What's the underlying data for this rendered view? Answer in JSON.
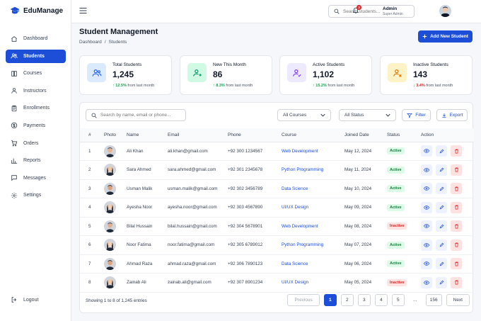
{
  "app": {
    "name": "EduManage"
  },
  "nav": [
    {
      "label": "Dashboard",
      "icon": "home-icon"
    },
    {
      "label": "Students",
      "icon": "students-icon",
      "active": true
    },
    {
      "label": "Courses",
      "icon": "book-icon"
    },
    {
      "label": "Instructors",
      "icon": "user-icon"
    },
    {
      "label": "Enrollments",
      "icon": "clipboard-icon"
    },
    {
      "label": "Payments",
      "icon": "dollar-icon"
    },
    {
      "label": "Orders",
      "icon": "cart-icon"
    },
    {
      "label": "Reports",
      "icon": "chart-icon"
    },
    {
      "label": "Messages",
      "icon": "message-icon"
    },
    {
      "label": "Settings",
      "icon": "gear-icon"
    }
  ],
  "logout": "Logout",
  "header": {
    "search_placeholder": "Search students...",
    "notification_count": "3",
    "admin_name": "Admin",
    "admin_role": "Super Admin"
  },
  "page": {
    "title": "Student Management",
    "breadcrumb": [
      "Dashboard",
      "/",
      "Students"
    ],
    "add_button": "Add New Student"
  },
  "stats": [
    {
      "label": "Total Students",
      "value": "1,245",
      "change": "↑ 12.5%",
      "suffix": "from last month",
      "trend": "up",
      "color": "#2563eb",
      "bg": "#dbeafe"
    },
    {
      "label": "New This Month",
      "value": "86",
      "change": "↑ 8.3%",
      "suffix": "from last month",
      "trend": "up",
      "color": "#059669",
      "bg": "#d1fae5"
    },
    {
      "label": "Active Students",
      "value": "1,102",
      "change": "↑ 15.2%",
      "suffix": "from last month",
      "trend": "up",
      "color": "#7c3aed",
      "bg": "#ede9fe"
    },
    {
      "label": "Inactive Students",
      "value": "143",
      "change": "↓ 3.4%",
      "suffix": "from last month",
      "trend": "down",
      "color": "#d97706",
      "bg": "#fef3c7"
    }
  ],
  "filters": {
    "search_placeholder": "Search by name, email or phone...",
    "course": "All Courses",
    "status": "All Status",
    "filter_label": "Filter",
    "export_label": "Export"
  },
  "table": {
    "columns": [
      "#",
      "Photo",
      "Name",
      "Email",
      "Phone",
      "Course",
      "Joined Date",
      "Status",
      "Action"
    ],
    "rows": [
      {
        "n": "1",
        "name": "Ali Khan",
        "email": "ali.khan@gmail.com",
        "phone": "+92 300 1234567",
        "course": "Web Development",
        "joined": "May 12, 2024",
        "status": "Active"
      },
      {
        "n": "2",
        "name": "Sara Ahmed",
        "email": "sara.ahmed@gmail.com",
        "phone": "+92 301 2345678",
        "course": "Python Programming",
        "joined": "May 11, 2024",
        "status": "Active"
      },
      {
        "n": "3",
        "name": "Usman Malik",
        "email": "usman.malik@gmail.com",
        "phone": "+92 302 3456789",
        "course": "Data Science",
        "joined": "May 10, 2024",
        "status": "Active"
      },
      {
        "n": "4",
        "name": "Ayesha Noor",
        "email": "ayesha.noor@gmail.com",
        "phone": "+92 303 4567890",
        "course": "UI/UX Design",
        "joined": "May 09, 2024",
        "status": "Active"
      },
      {
        "n": "5",
        "name": "Bilal Hussain",
        "email": "bilal.hussain@gmail.com",
        "phone": "+92 304 5678901",
        "course": "Web Development",
        "joined": "May 08, 2024",
        "status": "Inactive"
      },
      {
        "n": "6",
        "name": "Noor Fatima",
        "email": "noor.fatima@gmail.com",
        "phone": "+92 305 6789012",
        "course": "Python Programming",
        "joined": "May 07, 2024",
        "status": "Active"
      },
      {
        "n": "7",
        "name": "Ahmad Raza",
        "email": "ahmad.raza@gmail.com",
        "phone": "+92 306 7890123",
        "course": "Data Science",
        "joined": "May 06, 2024",
        "status": "Active"
      },
      {
        "n": "8",
        "name": "Zainab Ali",
        "email": "zainab.ali@gmail.com",
        "phone": "+92 307 8901234",
        "course": "UI/UX Design",
        "joined": "May 05, 2024",
        "status": "Inactive"
      }
    ]
  },
  "pagination": {
    "summary": "Showing 1 to 8 of 1,245 entries",
    "previous": "Previous",
    "pages": [
      "1",
      "2",
      "3",
      "4",
      "5",
      "...",
      "156"
    ],
    "next": "Next"
  }
}
